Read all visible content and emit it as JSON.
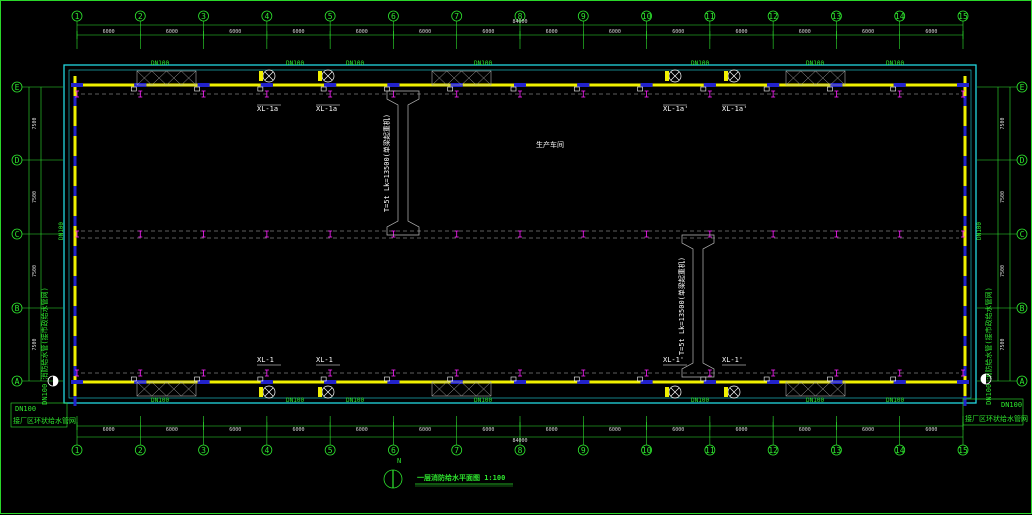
{
  "columns": [
    "1",
    "2",
    "3",
    "4",
    "5",
    "6",
    "7",
    "8",
    "9",
    "10",
    "11",
    "12",
    "13",
    "14",
    "15"
  ],
  "rows": [
    "E",
    "D",
    "C",
    "B",
    "A"
  ],
  "bay_dims_top": [
    "6000",
    "6000",
    "6000",
    "6000",
    "6000",
    "6000",
    "6000",
    "6000",
    "6000",
    "6000",
    "6000",
    "6000",
    "6000",
    "6000"
  ],
  "bay_dims_bottom": [
    "6000",
    "6000",
    "6000",
    "6000",
    "6000",
    "6000",
    "6000",
    "6000",
    "6000",
    "6000",
    "6000",
    "6000",
    "6000",
    "6000"
  ],
  "total_dim_top": "84000",
  "total_dim_bottom": "84000",
  "row_dims_left": [
    "7500",
    "7500",
    "7500",
    "7500"
  ],
  "row_dims_right": [
    "7500",
    "7500",
    "7500",
    "7500"
  ],
  "pipe_labels": {
    "top": [
      "DN100",
      "DN100",
      "DN100",
      "DN100",
      "DN100",
      "DN100",
      "DN100"
    ],
    "bottom": [
      "DN100",
      "DN100",
      "DN100",
      "DN100",
      "DN100",
      "DN100",
      "DN100"
    ],
    "left": "DN100",
    "right": "DN100"
  },
  "hydrant_labels": {
    "top": [
      "XL-1a",
      "XL-1a",
      "XL-1a'",
      "XL-1a'"
    ],
    "bottom": [
      "XL-1",
      "XL-1",
      "XL-1'",
      "XL-1'"
    ]
  },
  "room_label": "生产车间",
  "crane_label_1": "T=5t  Lk=13500(单梁起重机)",
  "crane_label_2": "T=5t  Lk=13500(单梁起重机)",
  "side_notes": {
    "left_vertical": "DN100 消防给水管(接市政给水管网)",
    "right_vertical": "DN100 消防给水管(接市政给水管网)",
    "left_box": "接厂区环状给水管网",
    "right_box": "接厂区环状给水管网",
    "left_code": "DN100",
    "right_code": "DN100"
  },
  "drawing_title": "一层消防给水平面图 1:100",
  "north_label": "N",
  "colors": {
    "grid_green": "#2ee62e",
    "wall_cyan": "#22d8e0",
    "pipe_yellow": "#f0f000",
    "column_magenta": "#ff22ff",
    "wall_blue": "#2222cc",
    "text_white": "#ffffff"
  }
}
